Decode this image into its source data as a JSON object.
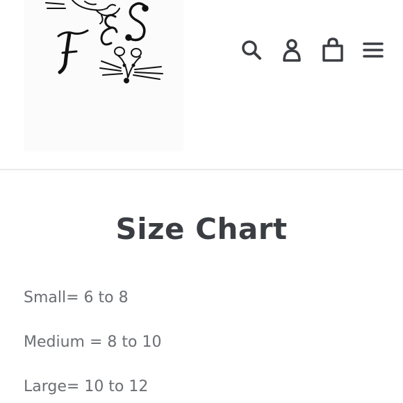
{
  "header": {
    "logo": {
      "icon": "fs-mouse-bird-logo",
      "text": "F&S"
    },
    "icons": [
      {
        "name": "search-icon"
      },
      {
        "name": "account-icon"
      },
      {
        "name": "cart-icon"
      },
      {
        "name": "menu-icon"
      }
    ]
  },
  "main": {
    "title": "Size Chart",
    "sizes": [
      {
        "text": "Small= 6 to 8"
      },
      {
        "text": "Medium = 8 to 10"
      },
      {
        "text": "Large= 10 to 12"
      }
    ]
  },
  "colors": {
    "title": "#3a3d42",
    "body_text": "#6b6e73",
    "icon": "#3a3d42",
    "divider": "#e9e9ea"
  }
}
